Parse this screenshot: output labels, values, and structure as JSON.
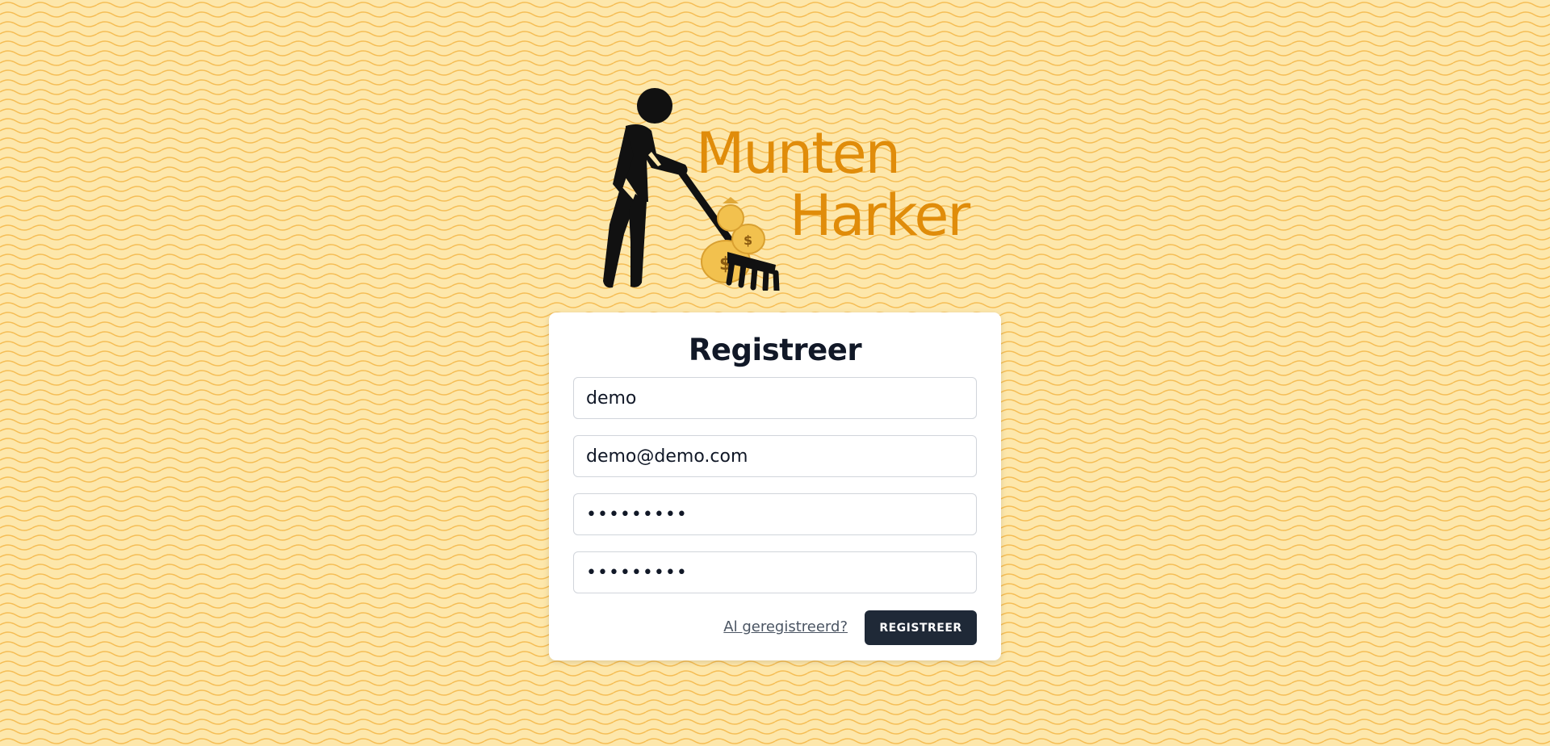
{
  "brand": {
    "line1": "Munten",
    "line2": "Harker",
    "color": "#e08c0a"
  },
  "form": {
    "title": "Registreer",
    "username_value": "demo",
    "email_value": "demo@demo.com",
    "password_value": "•••••••••",
    "password_confirm_value": "•••••••••",
    "login_link": "Al geregistreerd?",
    "submit_label": "REGISTREER"
  },
  "colors": {
    "background": "#fde7ab",
    "button": "#1f2937",
    "text": "#111827"
  },
  "icons": [
    "worker-raking-icon",
    "money-bag-icon"
  ]
}
